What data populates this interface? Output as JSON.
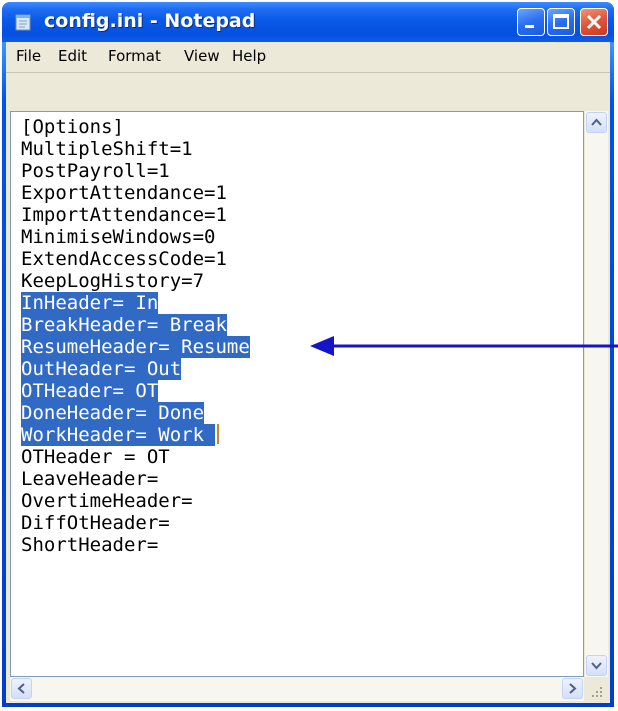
{
  "window": {
    "title": "config.ini - Notepad"
  },
  "menu": {
    "file": "File",
    "edit": "Edit",
    "format": "Format",
    "view": "View",
    "help": "Help"
  },
  "editor": {
    "lines": [
      "[Options]",
      "MultipleShift=1",
      "PostPayroll=1",
      "ExportAttendance=1",
      "ImportAttendance=1",
      "MinimiseWindows=0",
      "ExtendAccessCode=1",
      "KeepLogHistory=7",
      "InHeader= In",
      "BreakHeader= Break",
      "ResumeHeader= Resume",
      "OutHeader= Out",
      "OTHeader= OT",
      "DoneHeader= Done",
      "WorkHeader= Work ",
      "OTHeader = OT",
      "LeaveHeader=",
      "OvertimeHeader=",
      "DiffOtHeader=",
      "ShortHeader="
    ],
    "selected_line_indices": [
      8,
      9,
      10,
      11,
      12,
      13,
      14
    ]
  },
  "colors": {
    "selection": "#316ac5",
    "annotation_arrow": "#1414c8"
  },
  "icons": {
    "app": "notepad-icon",
    "minimize": "minimize-icon",
    "maximize": "maximize-icon",
    "close": "close-icon"
  }
}
